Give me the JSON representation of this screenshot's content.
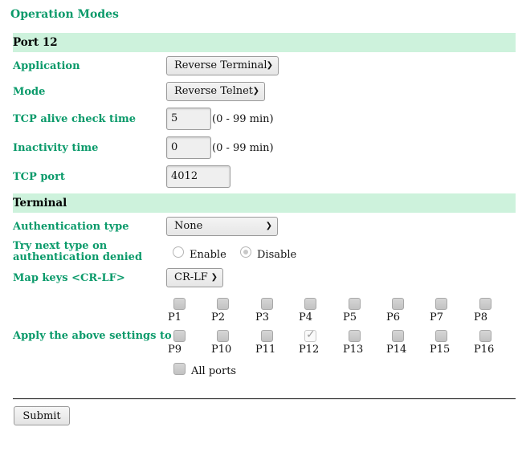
{
  "page": {
    "title": "Operation Modes"
  },
  "port_section": {
    "header": "Port 12",
    "application": {
      "label": "Application",
      "value": "Reverse Terminal"
    },
    "mode": {
      "label": "Mode",
      "value": "Reverse Telnet"
    },
    "tcp_alive": {
      "label": "TCP alive check time",
      "value": "5",
      "hint": "(0 - 99 min)"
    },
    "inactivity": {
      "label": "Inactivity time",
      "value": "0",
      "hint": "(0 - 99 min)"
    },
    "tcp_port": {
      "label": "TCP port",
      "value": "4012"
    }
  },
  "terminal_section": {
    "header": "Terminal",
    "auth_type": {
      "label": "Authentication type",
      "value": "None"
    },
    "try_next": {
      "label_line1": "Try next type on",
      "label_line2": "authentication denied",
      "options": [
        {
          "label": "Enable",
          "checked": false
        },
        {
          "label": "Disable",
          "checked": true
        }
      ]
    },
    "map_keys": {
      "label": "Map keys <CR-LF>",
      "value": "CR-LF"
    }
  },
  "apply": {
    "label": "Apply the above settings to",
    "ports": [
      {
        "label": "P1",
        "checked": false
      },
      {
        "label": "P2",
        "checked": false
      },
      {
        "label": "P3",
        "checked": false
      },
      {
        "label": "P4",
        "checked": false
      },
      {
        "label": "P5",
        "checked": false
      },
      {
        "label": "P6",
        "checked": false
      },
      {
        "label": "P7",
        "checked": false
      },
      {
        "label": "P8",
        "checked": false
      },
      {
        "label": "P9",
        "checked": false
      },
      {
        "label": "P10",
        "checked": false
      },
      {
        "label": "P11",
        "checked": false
      },
      {
        "label": "P12",
        "checked": true
      },
      {
        "label": "P13",
        "checked": false
      },
      {
        "label": "P14",
        "checked": false
      },
      {
        "label": "P15",
        "checked": false
      },
      {
        "label": "P16",
        "checked": false
      }
    ],
    "all_ports": {
      "label": "All ports",
      "checked": false
    }
  },
  "submit_label": "Submit",
  "icons": {
    "dropdown": "chevron-down-icon",
    "checkmark": "check-icon"
  },
  "colors": {
    "label_green": "#0a9a6a",
    "band_bg": "#cdf2dc"
  }
}
